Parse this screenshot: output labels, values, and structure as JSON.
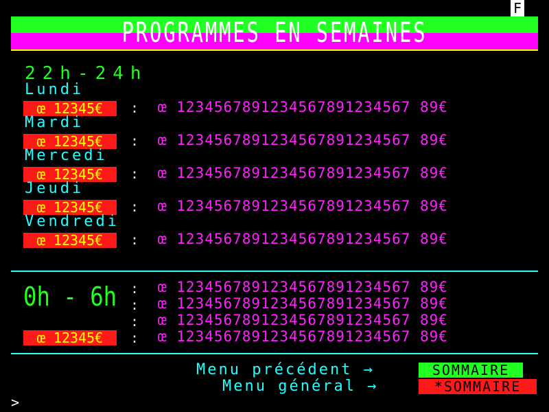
{
  "header": {
    "f_label": "F",
    "title": "PROGRAMMES EN SEMAINES"
  },
  "slot1": {
    "time": "22h-24h",
    "days": [
      {
        "label": "Lundi",
        "channel": "œ 12345€",
        "sep": ":",
        "program": "œ 1234567891234567891234567 89€"
      },
      {
        "label": "Mardi",
        "channel": "œ 12345€",
        "sep": ":",
        "program": "œ 1234567891234567891234567 89€"
      },
      {
        "label": "Mercedi",
        "channel": "œ 12345€",
        "sep": ":",
        "program": "œ 1234567891234567891234567 89€"
      },
      {
        "label": "Jeudi",
        "channel": "œ 12345€",
        "sep": ":",
        "program": "œ 1234567891234567891234567 89€"
      },
      {
        "label": "Vendredi",
        "channel": "œ 12345€",
        "sep": ":",
        "program": "œ 1234567891234567891234567 89€"
      }
    ]
  },
  "slot2": {
    "time": "0h - 6h",
    "channel": "œ 12345€",
    "lines": [
      {
        "sep": ":",
        "program": "œ 1234567891234567891234567 89€"
      },
      {
        "sep": ":",
        "program": "œ 1234567891234567891234567 89€"
      },
      {
        "sep": ":",
        "program": "œ 1234567891234567891234567 89€"
      },
      {
        "sep": ":",
        "program": "œ 1234567891234567891234567 89€"
      }
    ]
  },
  "footer": {
    "menu_previous": "Menu précédent →",
    "menu_general": "Menu général →",
    "btn_sommaire": "SOMMAIRE",
    "btn_star_sommaire": "*SOMMAIRE",
    "prompt": ">"
  },
  "colors": {
    "green": "#22ff22",
    "magenta": "#ff00ff",
    "cyan": "#22ffff",
    "red": "#ff1a1a",
    "yellow": "#ffff00"
  }
}
